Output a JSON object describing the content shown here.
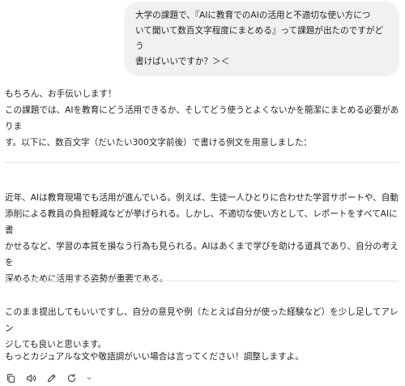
{
  "user_message": {
    "line1": "大学の課題で、『AIに教育でのAIの活用と不適切な使い方につ",
    "line2": "いて聞いて数百文字程度にまとめる』って課題が出たのですがどう",
    "line3": "書けばいいですか？＞＜"
  },
  "assistant": {
    "intro_line1": "もちろん、お手伝いします！",
    "intro_line2": "この課題では、AIを教育にどう活用できるか、そしてどう使うとよくないかを簡潔にまとめる必要がありま",
    "intro_line3": "す。以下に、数百文字（だいたい300文字前後）で書ける例文を用意しました：",
    "essay_line1": "近年、AIは教育現場でも活用が進んでいる。例えば、生徒一人ひとりに合わせた学習サポートや、自動",
    "essay_line2": "添削による教員の負担軽減などが挙げられる。しかし、不適切な使い方として、レポートをすべてAIに書",
    "essay_line3": "かせるなど、学習の本質を損なう行為も見られる。AIはあくまで学びを助ける道具であり、自分の考えを",
    "essay_line4": "深めるために活用する姿勢が重要である。",
    "outro_line1": "このまま提出してもいいですし、自分の意見や例（たとえば自分が使った経験など）を少し足してアレン",
    "outro_line2": "ジしても良いと思います。",
    "outro_line3": "もっとカジュアルな文や敬語調がいい場合は言ってください！調整しますよ。"
  },
  "toolbar": {
    "icons": [
      "copy-icon",
      "speaker-icon",
      "edit-icon",
      "regenerate-icon"
    ]
  }
}
